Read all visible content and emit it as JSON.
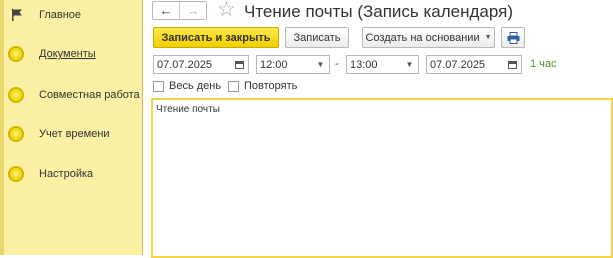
{
  "sidebar": {
    "items": [
      {
        "label": "Главное",
        "icon": "flag-icon"
      },
      {
        "label": "Документы",
        "icon": "circle-icon"
      },
      {
        "label": "Совместная работа",
        "icon": "circle-icon"
      },
      {
        "label": "Учет времени",
        "icon": "circle-icon"
      },
      {
        "label": "Настройка",
        "icon": "circle-icon"
      }
    ]
  },
  "header": {
    "title": "Чтение почты (Запись календаря)",
    "back_glyph": "←",
    "forward_glyph": "→",
    "star_glyph": "☆"
  },
  "toolbar": {
    "save_close_label": "Записать и закрыть",
    "save_label": "Записать",
    "create_based_label": "Создать на основании",
    "caret_glyph": "▼",
    "print_icon": "printer-icon"
  },
  "form": {
    "start_date": "07.07.2025",
    "start_time": "12:00",
    "dash": "-",
    "end_time": "13:00",
    "end_date": "07.07.2025",
    "duration": "1 час",
    "all_day_label": "Весь день",
    "repeat_label": "Повторять",
    "description": "Чтение почты"
  },
  "colors": {
    "sidebar_bg": "#fbf0a4",
    "primary_button": "#f1cf00",
    "accent_border": "#f3d34a",
    "duration_text": "#5a8a2a"
  }
}
